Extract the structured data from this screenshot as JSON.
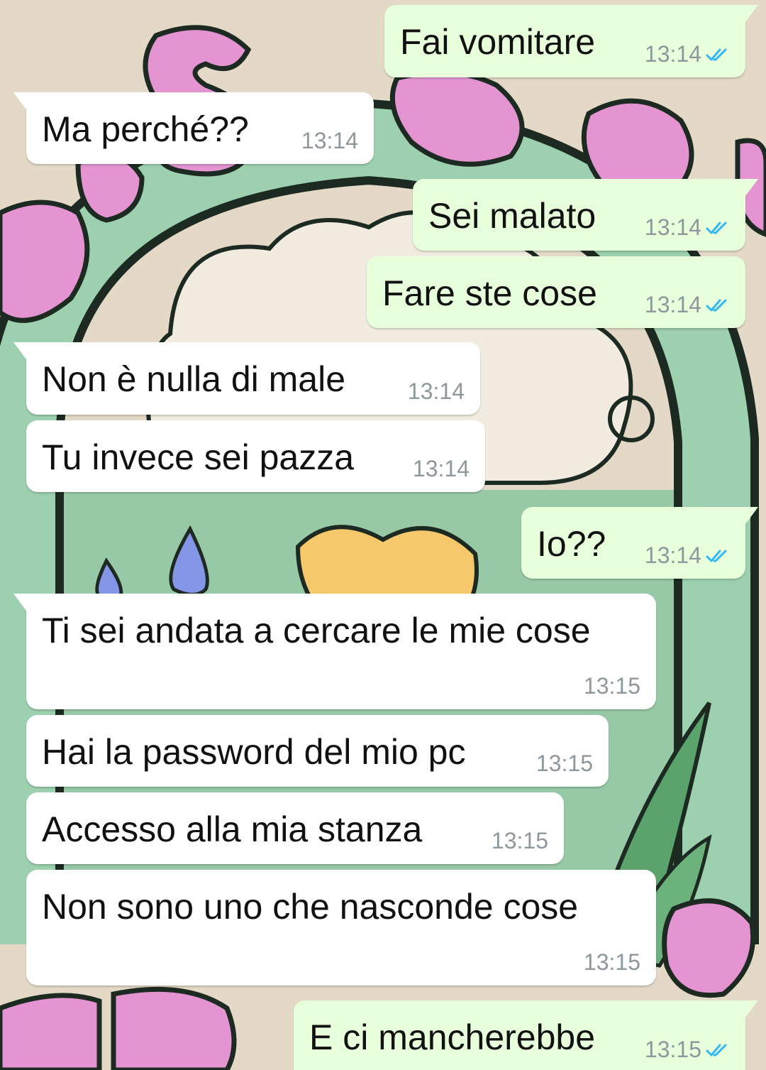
{
  "chat": {
    "messages": [
      {
        "direction": "out",
        "text": "Fai vomitare",
        "time": "13:14",
        "status": "read"
      },
      {
        "direction": "in",
        "text": "Ma perché??",
        "time": "13:14"
      },
      {
        "direction": "out",
        "text": "Sei malato",
        "time": "13:14",
        "status": "read"
      },
      {
        "direction": "out",
        "text": "Fare ste cose",
        "time": "13:14",
        "status": "read"
      },
      {
        "direction": "in",
        "text": "Non è nulla di male",
        "time": "13:14"
      },
      {
        "direction": "in",
        "text": "Tu invece sei pazza",
        "time": "13:14"
      },
      {
        "direction": "out",
        "text": "Io??",
        "time": "13:14",
        "status": "read"
      },
      {
        "direction": "in",
        "text": "Ti sei andata a cercare le mie cose",
        "time": "13:15"
      },
      {
        "direction": "in",
        "text": "Hai la password del mio pc",
        "time": "13:15"
      },
      {
        "direction": "in",
        "text": "Accesso alla mia stanza",
        "time": "13:15"
      },
      {
        "direction": "in",
        "text": "Non sono uno che nasconde cose",
        "time": "13:15"
      },
      {
        "direction": "out",
        "text": "E ci mancherebbe",
        "time": "13:15",
        "status": "read"
      }
    ]
  },
  "colors": {
    "incoming_bubble": "#ffffff",
    "outgoing_bubble": "#e7ffdb",
    "read_ticks": "#34b7f1",
    "timestamp": "#8e979b"
  }
}
